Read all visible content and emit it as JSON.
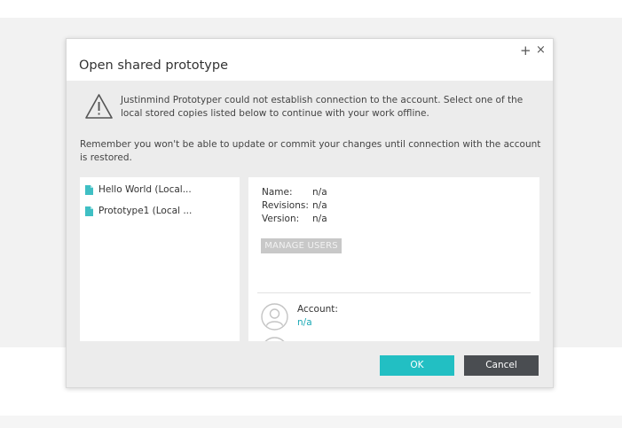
{
  "dialog": {
    "title": "Open shared prototype",
    "maximize_glyph": "+",
    "close_glyph": "×",
    "warning_text": "Justinmind Prototyper could not establish connection to the account. Select one of the local stored copies listed below to continue with your work offline.",
    "note_text": "Remember you won't be able to update or commit your changes until connection with the account is restored."
  },
  "files": [
    {
      "label": "Hello World (Local..."
    },
    {
      "label": "Prototype1 (Local ..."
    }
  ],
  "details": {
    "name_label": "Name:",
    "name_value": "n/a",
    "revisions_label": "Revisions:",
    "revisions_value": "n/a",
    "version_label": "Version:",
    "version_value": "n/a",
    "manage_users_label": "MANAGE USERS",
    "account_label": "Account:",
    "account_value": "n/a"
  },
  "buttons": {
    "ok_label": "OK",
    "cancel_label": "Cancel"
  },
  "colors": {
    "accent": "#22bfc3",
    "cancel_bg": "#4a4d51",
    "file_icon": "#3fbfc4",
    "link": "#1aa9b5"
  }
}
